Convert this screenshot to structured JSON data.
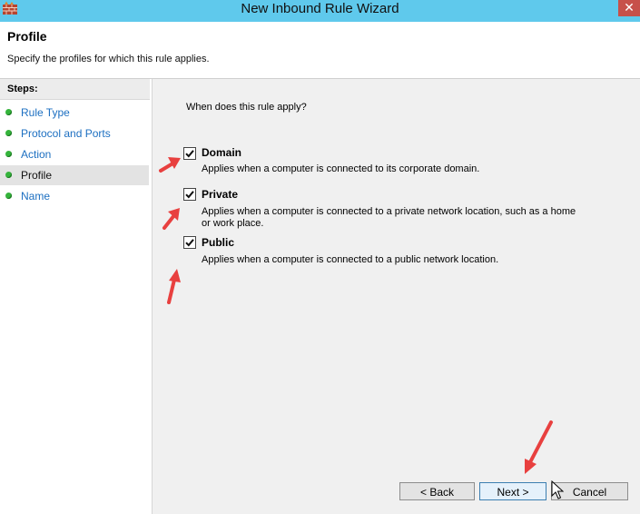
{
  "window": {
    "title": "New Inbound Rule Wizard",
    "close_glyph": "✕",
    "icon": "firewall-wall-icon"
  },
  "header": {
    "title": "Profile",
    "subtitle": "Specify the profiles for which this rule applies."
  },
  "steps": {
    "header": "Steps:",
    "items": [
      {
        "label": "Rule Type",
        "active": false
      },
      {
        "label": "Protocol and Ports",
        "active": false
      },
      {
        "label": "Action",
        "active": false
      },
      {
        "label": "Profile",
        "active": true
      },
      {
        "label": "Name",
        "active": false
      }
    ]
  },
  "content": {
    "question": "When does this rule apply?",
    "options": [
      {
        "label": "Domain",
        "checked": true,
        "description": "Applies when a computer is connected to its corporate domain."
      },
      {
        "label": "Private",
        "checked": true,
        "description": "Applies when a computer is connected to a private network location, such as a home or work place."
      },
      {
        "label": "Public",
        "checked": true,
        "description": "Applies when a computer is connected to a public network location."
      }
    ]
  },
  "buttons": {
    "back": "< Back",
    "next": "Next >",
    "cancel": "Cancel"
  },
  "colors": {
    "titlebar": "#5fc9ec",
    "annotation_arrow": "#e8403f",
    "step_link": "#1c6fc1",
    "step_dot": "#35b43c"
  }
}
